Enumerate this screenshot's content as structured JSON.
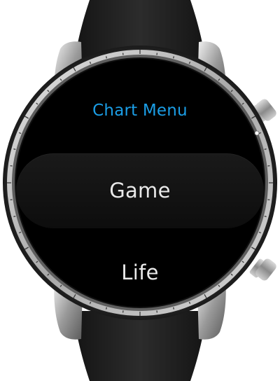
{
  "app": {
    "title": "Chart Menu"
  },
  "menu": {
    "items": [
      {
        "label": "Game",
        "selected": true
      },
      {
        "label": "Life",
        "selected": false
      }
    ]
  },
  "colors": {
    "title": "#1b9ee6",
    "item_text": "#e9e9e9",
    "screen_bg": "#000000",
    "strap": "#262626",
    "bezel": "#bdbdbd"
  }
}
